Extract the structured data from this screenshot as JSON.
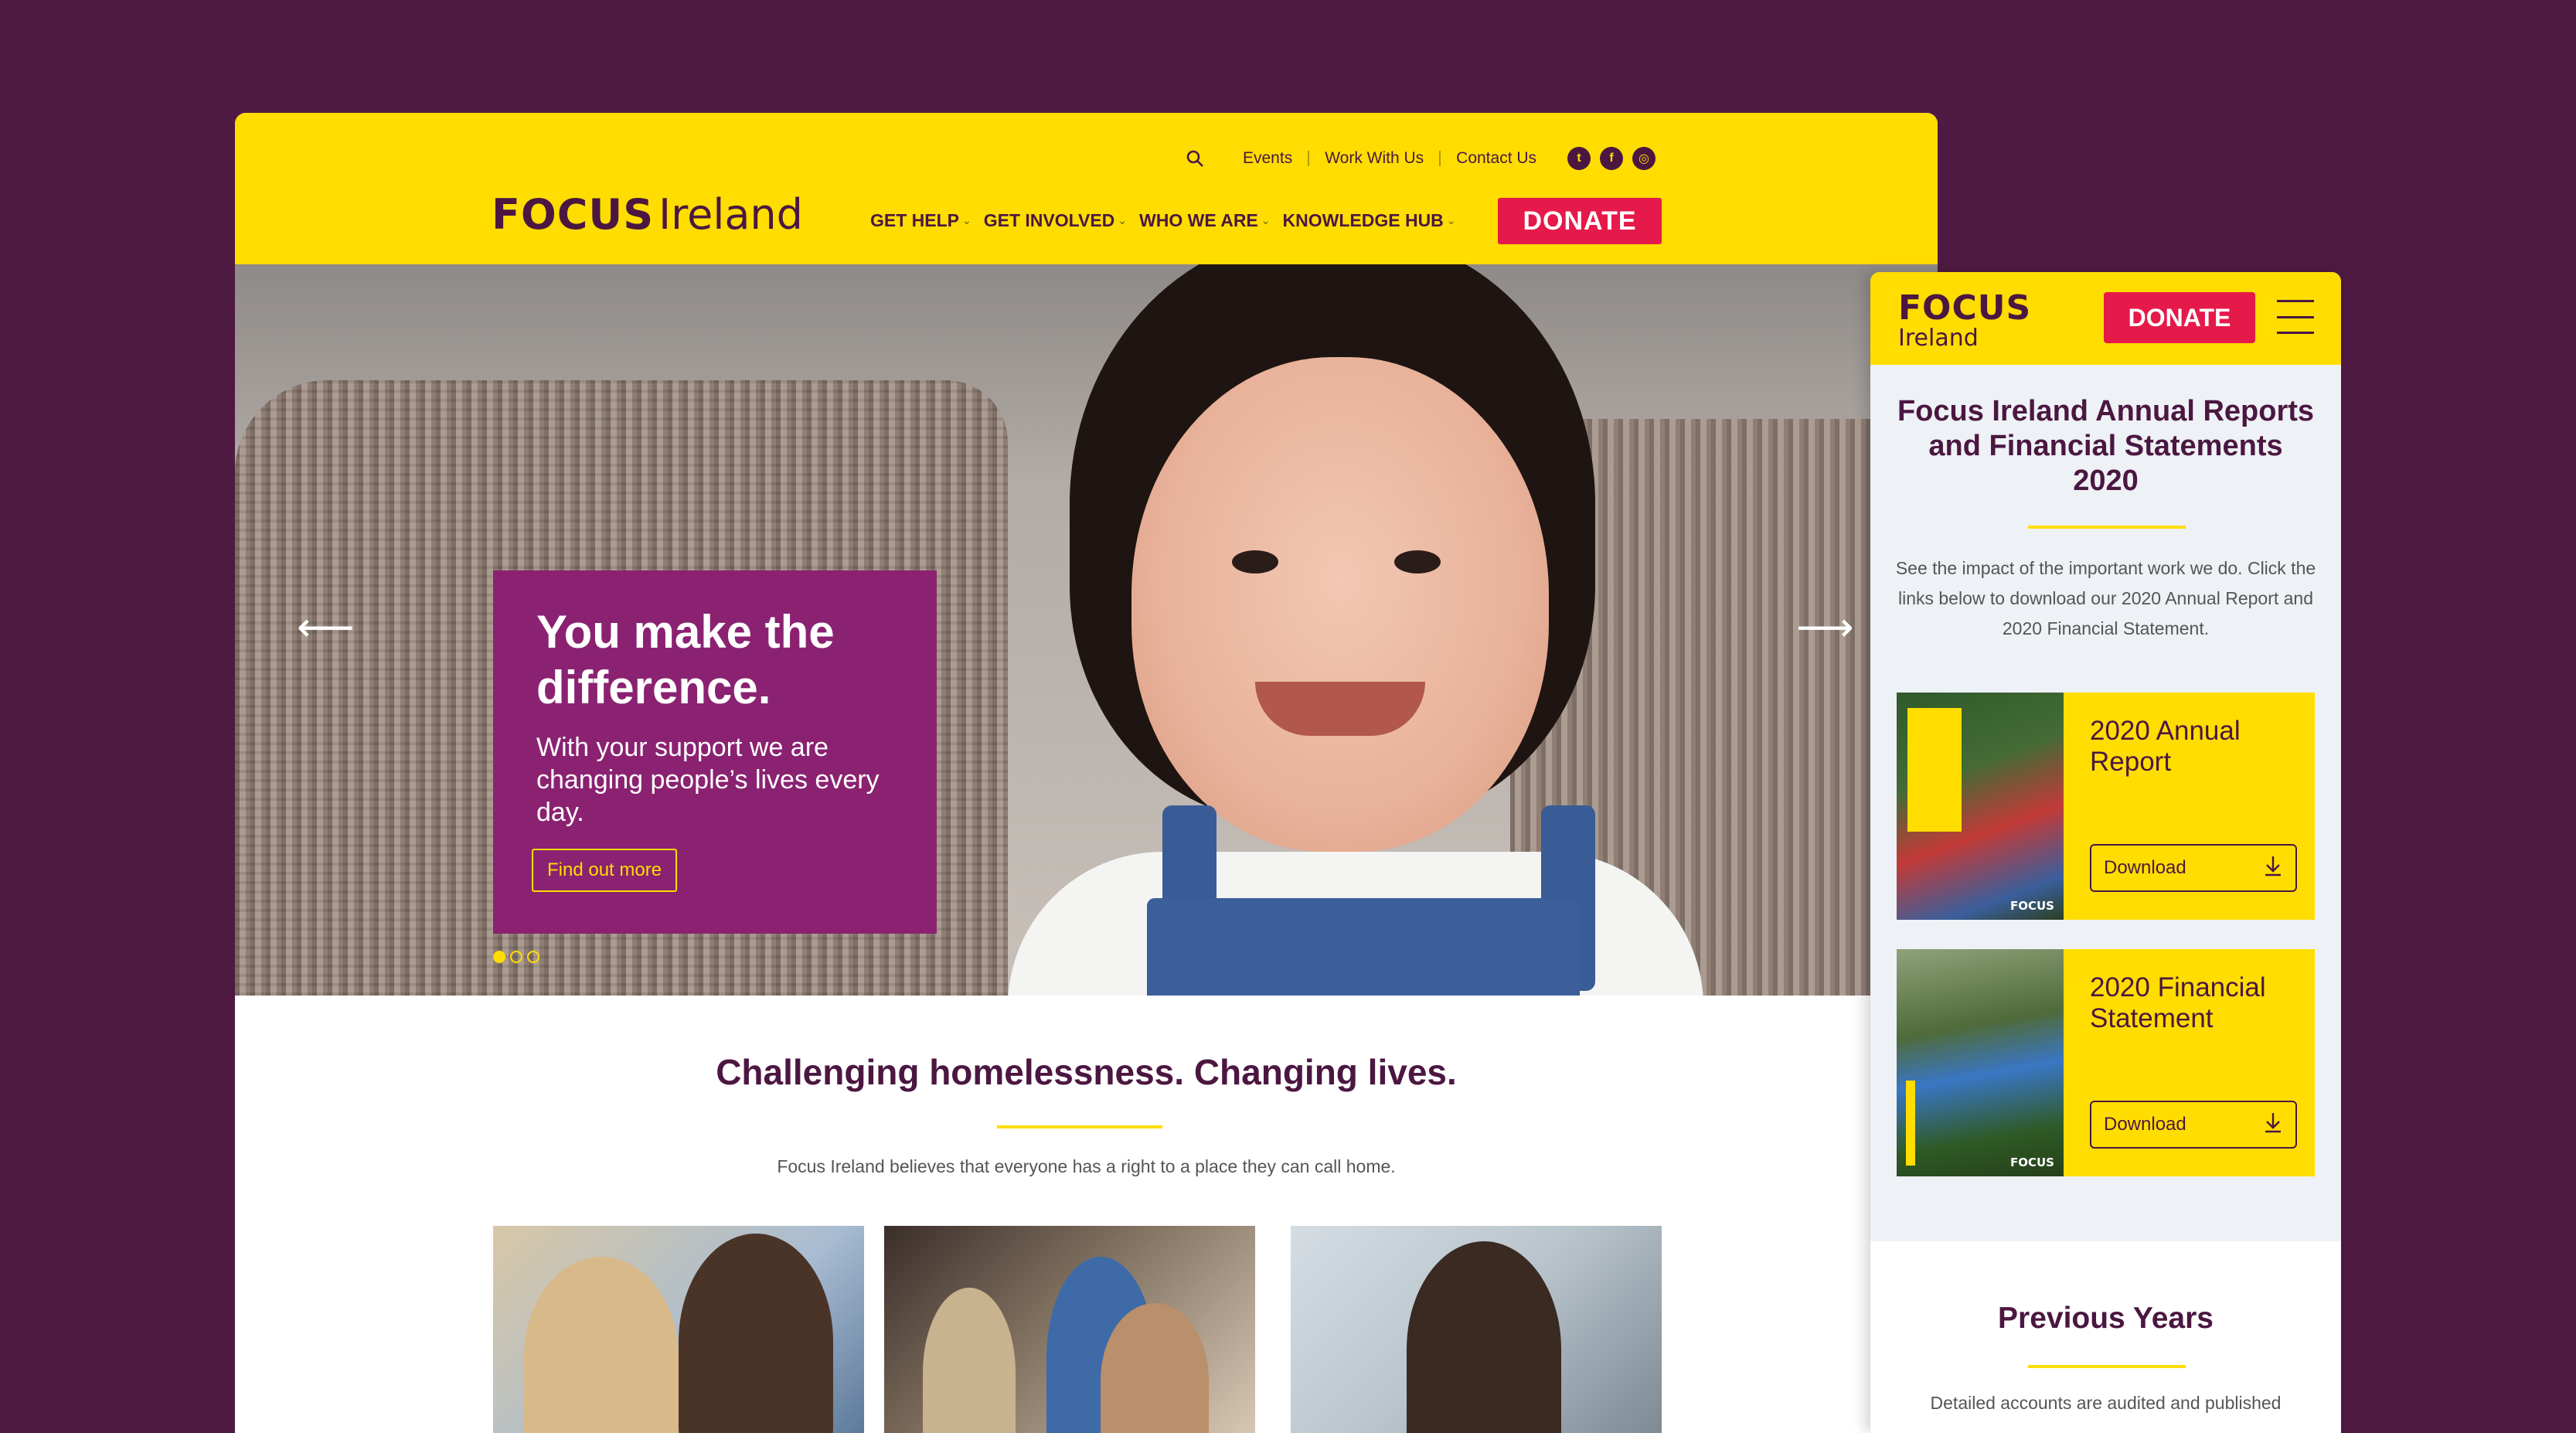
{
  "desktop": {
    "logo": {
      "focus": "FOCUS",
      "ireland": "Ireland"
    },
    "utility_nav": [
      "Events",
      "Work With Us",
      "Contact Us"
    ],
    "social_icons": [
      "twitter-icon",
      "facebook-icon",
      "instagram-icon"
    ],
    "main_nav": [
      "GET HELP",
      "GET INVOLVED",
      "WHO WE ARE",
      "KNOWLEDGE HUB"
    ],
    "donate_label": "DONATE",
    "hero": {
      "heading": "You make the difference.",
      "subtext": "With your support we are changing people’s lives every day.",
      "cta": "Find out more",
      "slide_count": 3,
      "active_slide": 1
    },
    "tagline": "Challenging homelessness. Changing lives.",
    "intro": "Focus Ireland believes that everyone has a right to a place they can call home."
  },
  "mobile": {
    "logo": {
      "focus": "FOCUS",
      "ireland": "Ireland"
    },
    "donate_label": "DONATE",
    "title": "Focus Ireland Annual Reports and Financial Statements 2020",
    "intro": "See the impact of the important work we do. Click the links below to download our 2020 Annual Report and 2020 Financial Statement.",
    "documents": [
      {
        "title": "2020 Annual Report",
        "download_label": "Download",
        "cover_label": "FOCUS"
      },
      {
        "title": "2020 Financial Statement",
        "download_label": "Download",
        "cover_label": "FOCUS"
      }
    ],
    "previous": {
      "heading": "Previous Years",
      "text": "Detailed accounts are audited and published"
    }
  },
  "colors": {
    "background": "#4f1a42",
    "brand_yellow": "#ffdd00",
    "brand_purple": "#4b1741",
    "hero_card": "#8a2271",
    "donate_red": "#e6194b"
  }
}
